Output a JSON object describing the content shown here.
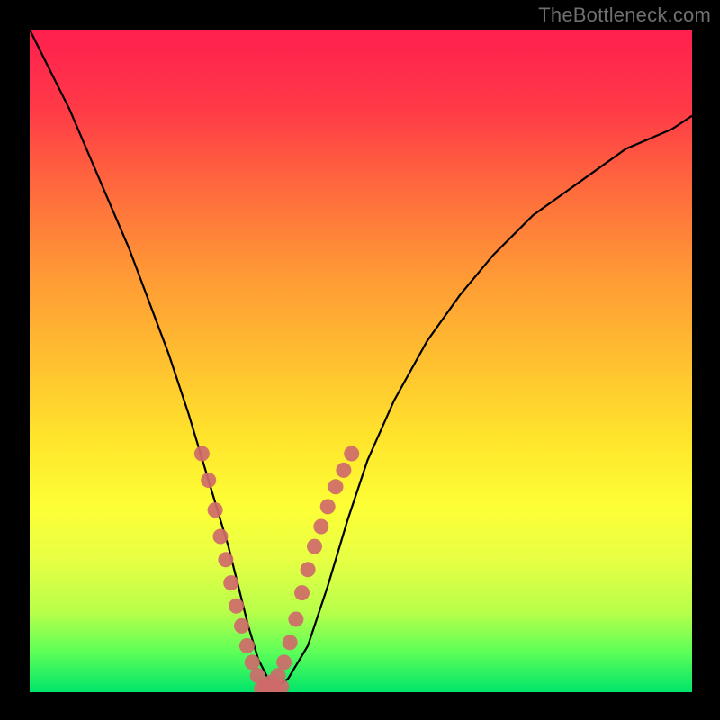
{
  "watermark": "TheBottleneck.com",
  "colors": {
    "frame": "#000000",
    "curve": "#000000",
    "marker": "#cf6a6a",
    "gradient_top": "#ff1f4f",
    "gradient_bottom": "#00e46a"
  },
  "chart_data": {
    "type": "line",
    "title": "",
    "xlabel": "",
    "ylabel": "",
    "xlim": [
      0,
      100
    ],
    "ylim": [
      0,
      100
    ],
    "grid": false,
    "legend": false,
    "note": "Axes are unlabeled; values are read off pixel proportions of the 736x736 plot area.",
    "series": [
      {
        "name": "bottleneck-curve",
        "x": [
          0,
          3,
          6,
          9,
          12,
          15,
          18,
          21,
          24,
          27,
          30,
          31.5,
          33,
          34.5,
          36,
          37.5,
          39,
          42,
          45,
          48,
          51,
          55,
          60,
          65,
          70,
          76,
          83,
          90,
          97,
          100
        ],
        "y": [
          100,
          94,
          88,
          81,
          74,
          67,
          59,
          51,
          42,
          32,
          22,
          16,
          10,
          5,
          2,
          1,
          2,
          7,
          16,
          26,
          35,
          44,
          53,
          60,
          66,
          72,
          77,
          82,
          85,
          87
        ]
      },
      {
        "name": "markers-left-arm",
        "style": "scatter",
        "x": [
          26.0,
          27.0,
          28.0,
          28.8,
          29.6,
          30.4,
          31.2,
          32.0,
          32.8,
          33.6,
          34.4
        ],
        "y": [
          36.0,
          32.0,
          27.5,
          23.5,
          20.0,
          16.5,
          13.0,
          10.0,
          7.0,
          4.5,
          2.5
        ]
      },
      {
        "name": "markers-right-arm",
        "style": "scatter",
        "x": [
          35.5,
          36.5,
          37.5,
          38.4,
          39.3,
          40.2,
          41.1,
          42.0,
          43.0,
          44.0,
          45.0,
          46.2,
          47.4,
          48.6
        ],
        "y": [
          1.0,
          1.5,
          2.5,
          4.5,
          7.5,
          11.0,
          15.0,
          18.5,
          22.0,
          25.0,
          28.0,
          31.0,
          33.5,
          36.0
        ]
      },
      {
        "name": "markers-bottom",
        "style": "scatter",
        "x": [
          35.0,
          36.0,
          37.0,
          38.0
        ],
        "y": [
          0.5,
          0.5,
          0.6,
          0.8
        ]
      }
    ]
  }
}
